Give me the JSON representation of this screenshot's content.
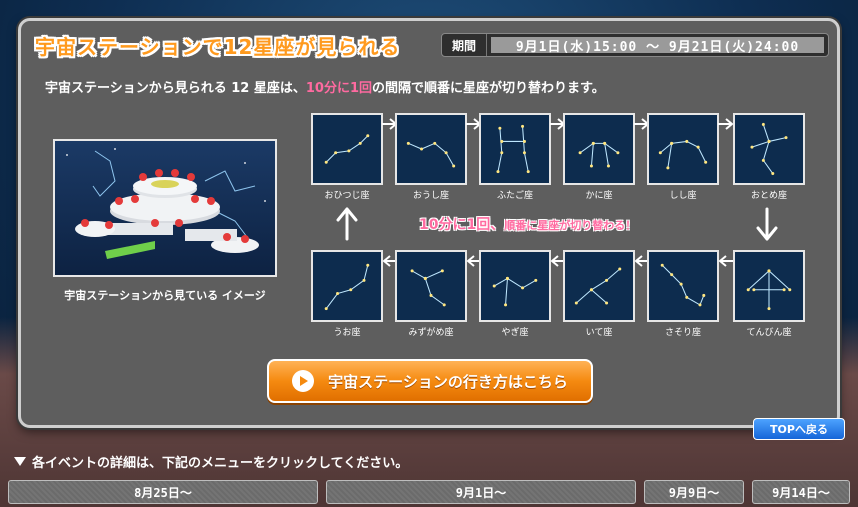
{
  "header": {
    "title": "宇宙ステーションで12星座が見られる",
    "period_label": "期間",
    "period_value": "9月1日(水)15:00 〜 9月21日(火)24:00"
  },
  "lead": {
    "before": "宇宙ステーションから見られる 12 星座は、",
    "emphasis": "10分に1回",
    "after": "の間隔で順番に星座が切り替わります。"
  },
  "station_image": {
    "caption": "宇宙ステーションから見ている イメージ"
  },
  "constellations_top": [
    {
      "label": "おひつじ座",
      "icon": "aries-constellation-icon"
    },
    {
      "label": "おうし座",
      "icon": "taurus-constellation-icon"
    },
    {
      "label": "ふたご座",
      "icon": "gemini-constellation-icon"
    },
    {
      "label": "かに座",
      "icon": "cancer-constellation-icon"
    },
    {
      "label": "しし座",
      "icon": "leo-constellation-icon"
    },
    {
      "label": "おとめ座",
      "icon": "virgo-constellation-icon"
    }
  ],
  "constellations_bottom": [
    {
      "label": "うお座",
      "icon": "pisces-constellation-icon"
    },
    {
      "label": "みずがめ座",
      "icon": "aquarius-constellation-icon"
    },
    {
      "label": "やぎ座",
      "icon": "capricorn-constellation-icon"
    },
    {
      "label": "いて座",
      "icon": "sagittarius-constellation-icon"
    },
    {
      "label": "さそり座",
      "icon": "scorpio-constellation-icon"
    },
    {
      "label": "てんびん座",
      "icon": "libra-constellation-icon"
    }
  ],
  "center_note": {
    "main": "10分に1回、",
    "sub": "順番に星座が切り替わる！"
  },
  "cta": {
    "label": "宇宙ステーションの行き方はこちら"
  },
  "top_button": {
    "label": "TOPへ戻る"
  },
  "events_note": "各イベントの詳細は、下記のメニューをクリックしてください。",
  "event_menu": [
    {
      "label": "8月25日〜"
    },
    {
      "label": "9月1日〜"
    },
    {
      "label": "9月9日〜"
    },
    {
      "label": "9月14日〜"
    }
  ],
  "colors": {
    "accent_orange": "#f58a10",
    "accent_pink": "#ff6aa0",
    "panel_gray": "#5e5e5e",
    "tile_navy": "#0d2c4e",
    "button_blue": "#1565d8"
  }
}
